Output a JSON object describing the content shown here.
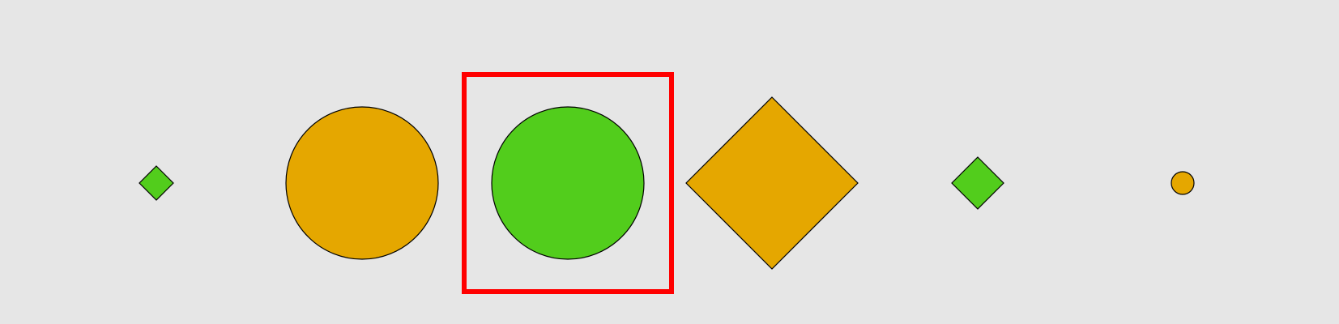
{
  "canvas": {
    "background": "#e6e6e6"
  },
  "colors": {
    "orange": "#e5a700",
    "green": "#52cd1c",
    "outline": "#000000",
    "highlight": "#ff0000"
  },
  "shapes": [
    {
      "kind": "diamond",
      "color": "green",
      "size": "small"
    },
    {
      "kind": "circle",
      "color": "orange",
      "size": "large"
    },
    {
      "kind": "circle",
      "color": "green",
      "size": "large",
      "highlighted": true
    },
    {
      "kind": "diamond",
      "color": "orange",
      "size": "large"
    },
    {
      "kind": "diamond",
      "color": "green",
      "size": "medium"
    },
    {
      "kind": "circle",
      "color": "orange",
      "size": "small"
    }
  ]
}
